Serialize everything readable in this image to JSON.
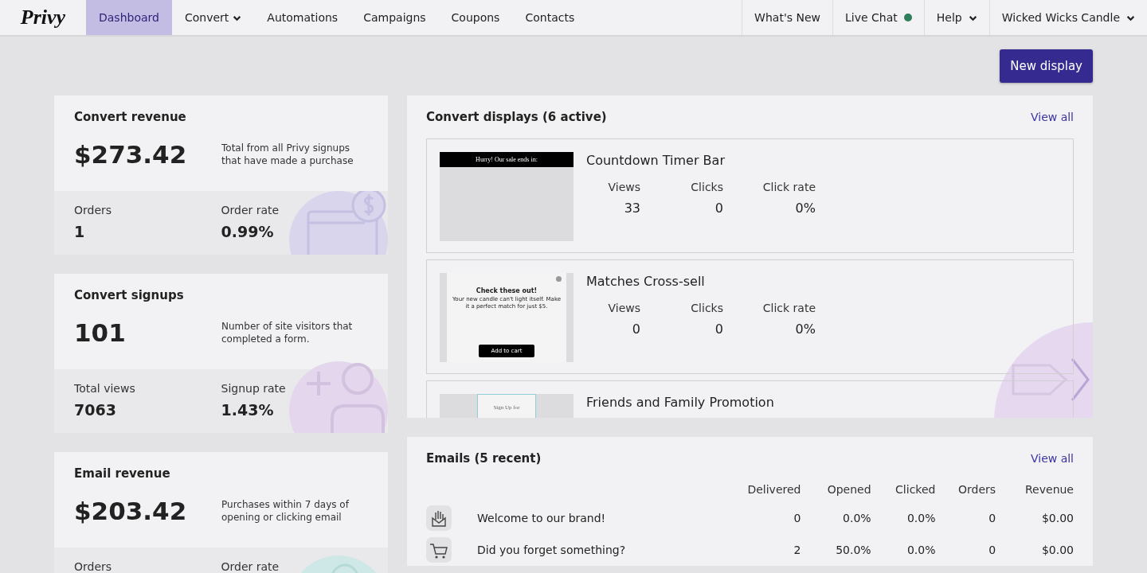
{
  "nav": {
    "logo": "Privy",
    "tabs": [
      {
        "label": "Dashboard",
        "selected": true,
        "dropdown": false
      },
      {
        "label": "Convert",
        "selected": false,
        "dropdown": true
      },
      {
        "label": "Automations",
        "selected": false,
        "dropdown": false
      },
      {
        "label": "Campaigns",
        "selected": false,
        "dropdown": false
      },
      {
        "label": "Coupons",
        "selected": false,
        "dropdown": false
      },
      {
        "label": "Contacts",
        "selected": false,
        "dropdown": false
      }
    ],
    "right_items": [
      {
        "label": "What's New",
        "dropdown": false
      },
      {
        "label": "Live Chat",
        "dropdown": false,
        "online": true
      },
      {
        "label": "Help",
        "dropdown": true
      },
      {
        "label": "Wicked Wicks Candle",
        "dropdown": true
      }
    ]
  },
  "new_display_button": "New display",
  "stat_cards": [
    {
      "title": "Convert revenue",
      "value": "$273.42",
      "description": "Total from all Privy signups that have made a purchase",
      "metrics": [
        {
          "label": "Orders",
          "value": "1"
        },
        {
          "label": "Order rate",
          "value": "0.99%"
        }
      ]
    },
    {
      "title": "Convert signups",
      "value": "101",
      "description": "Number of site visitors that completed a form.",
      "metrics": [
        {
          "label": "Total views",
          "value": "7063"
        },
        {
          "label": "Signup rate",
          "value": "1.43%"
        }
      ]
    },
    {
      "title": "Email revenue",
      "value": "$203.42",
      "description": "Purchases within 7 days of opening or clicking email",
      "metrics": [
        {
          "label": "Orders"
        },
        {
          "label": "Order rate"
        }
      ]
    }
  ],
  "displays": {
    "title": "Convert displays (6 active)",
    "view_all": "View all",
    "items": [
      {
        "name": "Countdown Timer Bar",
        "preview_text": [
          "Hurry! Our sale ends in:"
        ],
        "stats": [
          {
            "label": "Views",
            "value": "33"
          },
          {
            "label": "Clicks",
            "value": "0"
          },
          {
            "label": "Click rate",
            "value": "0%"
          }
        ]
      },
      {
        "name": "Matches Cross-sell",
        "preview_text": [
          "Check these out!",
          "Your new candle can't light itself. Make it a perfect match for just $5.",
          "Add to cart"
        ],
        "stats": [
          {
            "label": "Views",
            "value": "0"
          },
          {
            "label": "Clicks",
            "value": "0"
          },
          {
            "label": "Click rate",
            "value": "0%"
          }
        ]
      },
      {
        "name": "Friends and Family Promotion",
        "preview_text": [
          "Sign Up for"
        ]
      }
    ]
  },
  "emails": {
    "title": "Emails (5 recent)",
    "view_all": "View all",
    "columns": [
      "Delivered",
      "Opened",
      "Clicked",
      "Orders",
      "Revenue"
    ],
    "rows": [
      {
        "name": "Welcome to our brand!",
        "cells": [
          "0",
          "0.0%",
          "0.0%",
          "0",
          "$0.00"
        ]
      },
      {
        "name": "Did you forget something?",
        "cells": [
          "2",
          "50.0%",
          "0.0%",
          "0",
          "$0.00"
        ]
      }
    ]
  }
}
